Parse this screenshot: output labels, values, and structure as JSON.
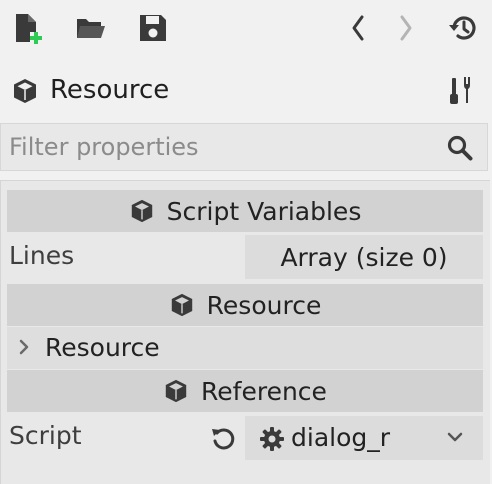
{
  "toolbar": {
    "new_icon": "new-resource-icon",
    "open_icon": "folder-open-icon",
    "save_icon": "save-icon",
    "back_icon": "chevron-left-icon",
    "forward_icon": "chevron-right-icon",
    "history_icon": "history-icon"
  },
  "resource_header": {
    "title": "Resource",
    "icon": "cube-icon",
    "tools_icon": "tools-icon"
  },
  "filter": {
    "placeholder": "Filter properties",
    "value": "",
    "icon": "search-icon"
  },
  "inspector": {
    "sections": [
      {
        "title": "Script Variables"
      },
      {
        "title": "Resource"
      },
      {
        "title": "Reference"
      }
    ],
    "lines": {
      "label": "Lines",
      "value": "Array (size 0)"
    },
    "resource_group": {
      "label": "Resource"
    },
    "script": {
      "label": "Script",
      "value": "dialog_r"
    }
  },
  "colors": {
    "background": "#f1f1f1",
    "section_bg": "#d2d2d2",
    "value_bg": "#dcdcdc",
    "new_plus": "#2ecc55",
    "icon_dark": "#3a3a3a",
    "icon_muted": "#b4b4b4"
  }
}
